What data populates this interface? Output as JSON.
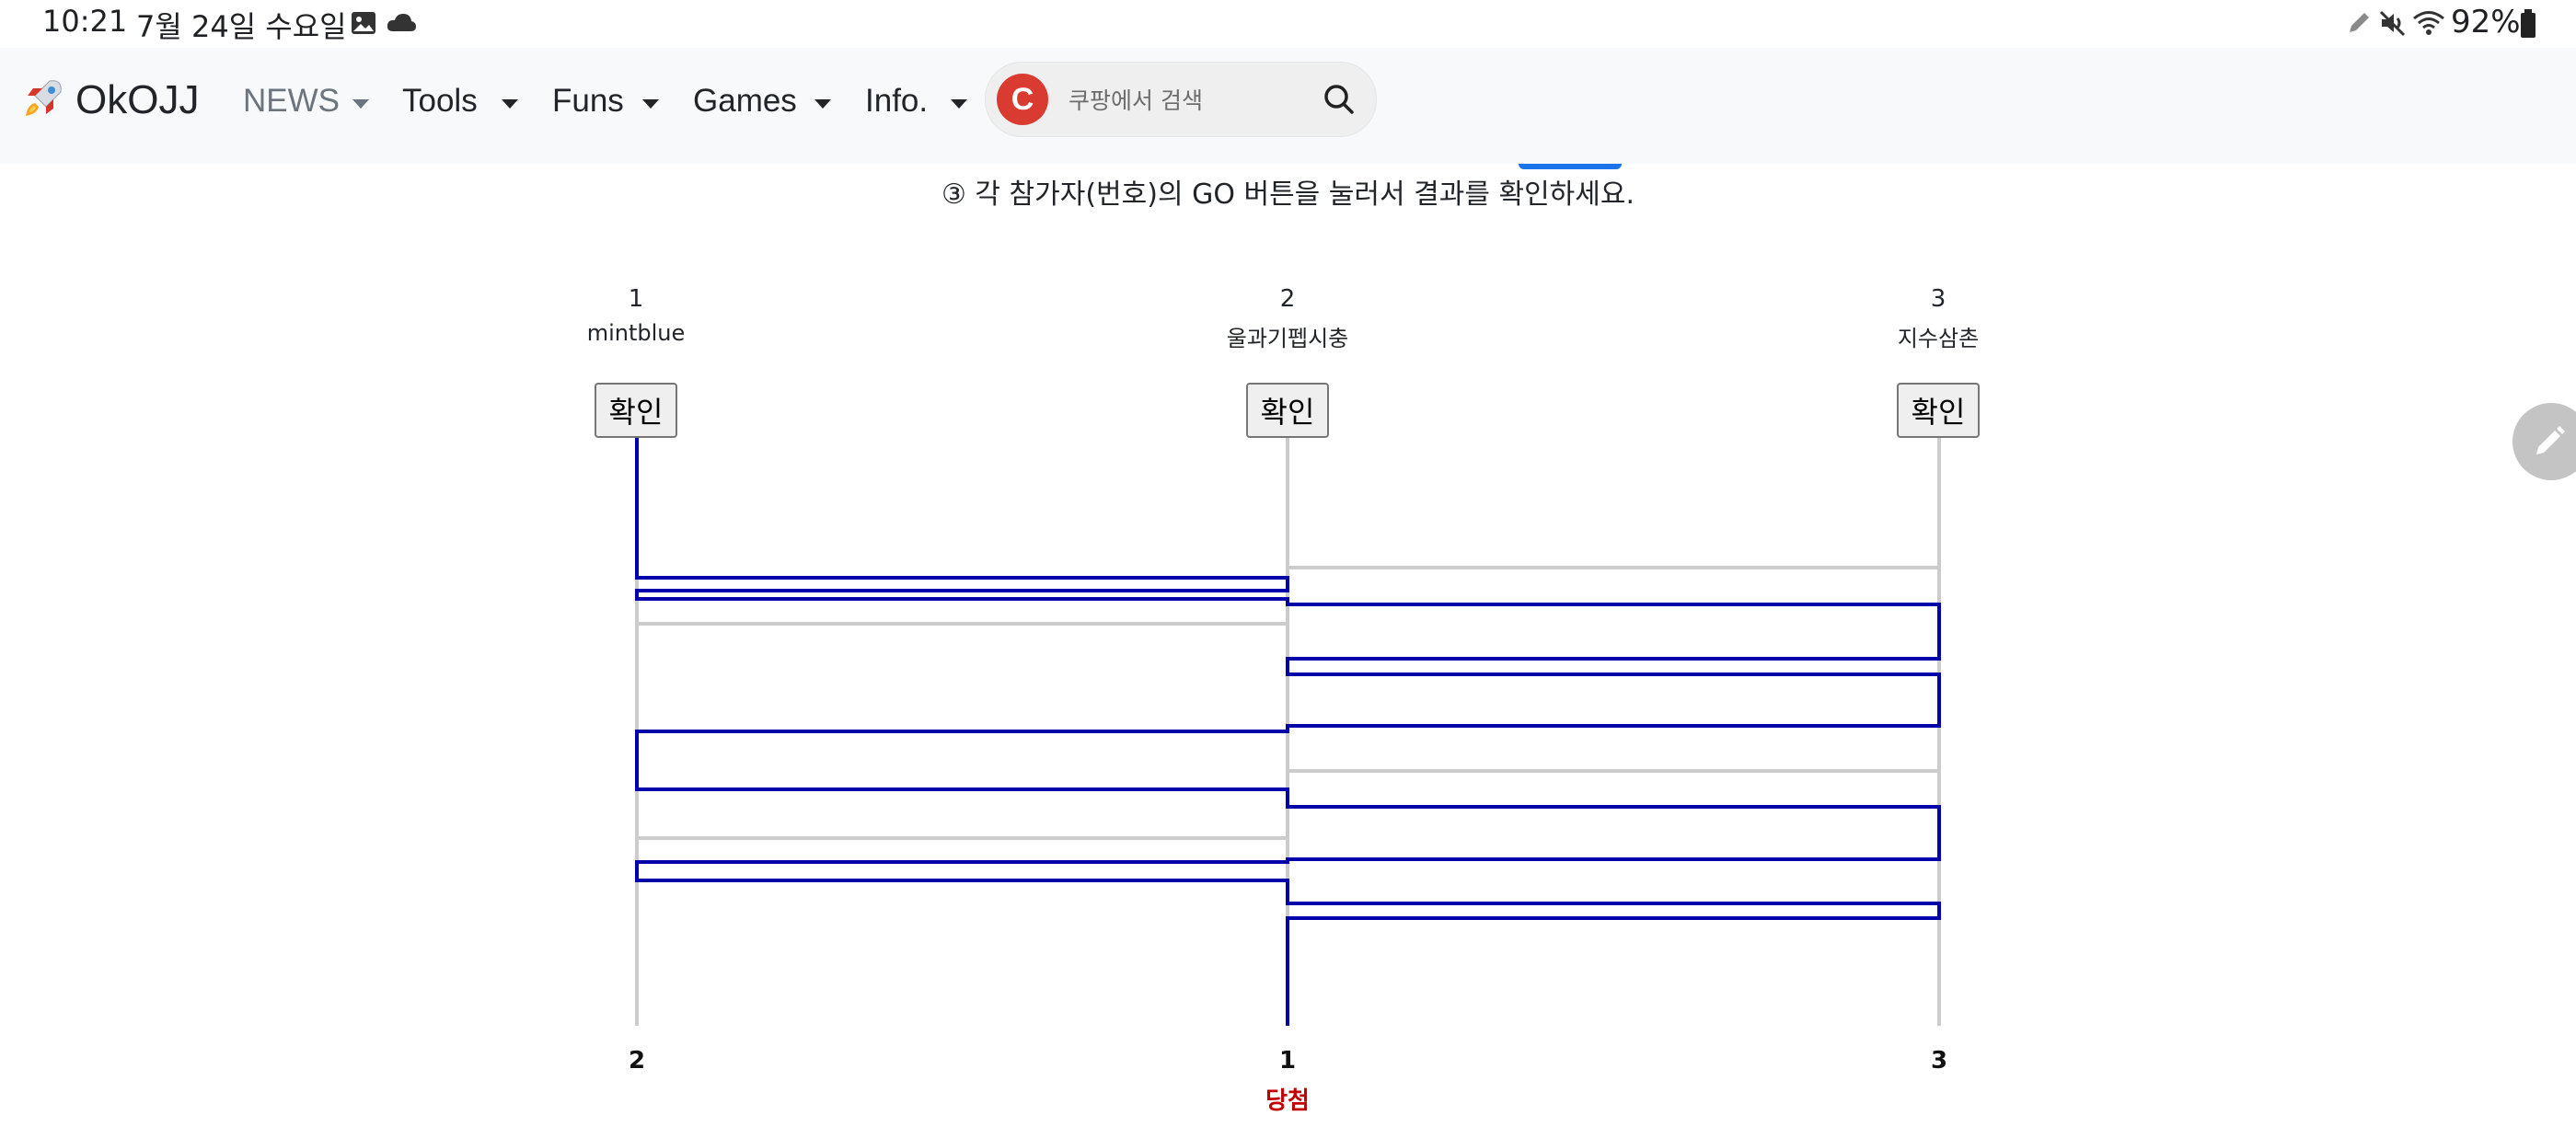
{
  "status_bar": {
    "time": "10:21",
    "date": "7월 24일 수요일",
    "battery": "92%",
    "icons": [
      "gallery-icon",
      "cloud-icon",
      "pen-icon",
      "mute-icon",
      "wifi-icon",
      "battery-icon"
    ]
  },
  "navbar": {
    "brand": "OkOJJ",
    "items": [
      {
        "label": "NEWS"
      },
      {
        "label": "Tools"
      },
      {
        "label": "Funs"
      },
      {
        "label": "Games"
      },
      {
        "label": "Info."
      }
    ],
    "search": {
      "placeholder": "쿠팡에서 검색",
      "logo_letter": "C"
    }
  },
  "instruction": "③ 각 참가자(번호)의 GO 버튼을 눌러서 결과를 확인하세요.",
  "ladder": {
    "participants": [
      {
        "number": "1",
        "name": "mintblue",
        "button": "확인"
      },
      {
        "number": "2",
        "name": "울과기펩시충",
        "button": "확인"
      },
      {
        "number": "3",
        "name": "지수삼촌",
        "button": "확인"
      }
    ],
    "results": [
      "2",
      "1",
      "3"
    ],
    "winner_label": "당첨",
    "winner_column": 1,
    "path_color": "#0000aa",
    "line_color": "#cccccc"
  },
  "colors": {
    "navbar_bg": "#f8f9fa",
    "accent": "#1a73e8",
    "winner": "#c00000"
  }
}
